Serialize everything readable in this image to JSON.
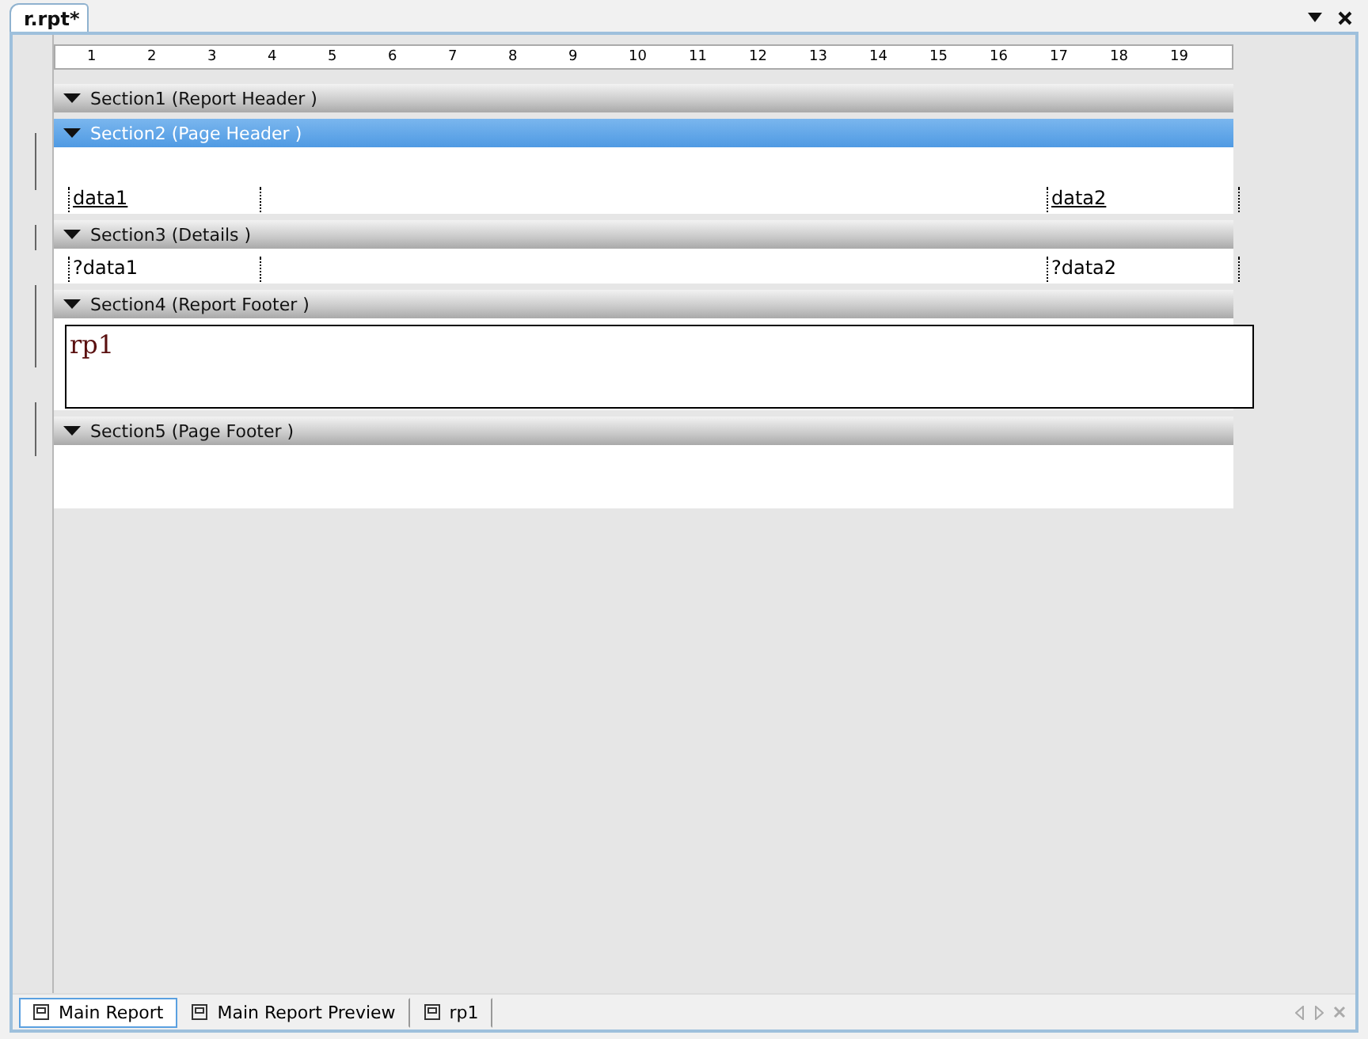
{
  "document_tab": {
    "label": "r.rpt*"
  },
  "ruler": {
    "marks": [
      "1",
      "2",
      "3",
      "4",
      "5",
      "6",
      "7",
      "8",
      "9",
      "10",
      "11",
      "12",
      "13",
      "14",
      "15",
      "16",
      "17",
      "18",
      "19"
    ]
  },
  "sections": [
    {
      "title": "Section1 (Report Header )",
      "selected": false
    },
    {
      "title": "Section2 (Page Header )",
      "selected": true,
      "fields": [
        {
          "kind": "label",
          "text": "data1"
        },
        {
          "kind": "label",
          "text": "data2"
        }
      ]
    },
    {
      "title": "Section3 (Details )",
      "selected": false,
      "fields": [
        {
          "kind": "value",
          "text": "?data1"
        },
        {
          "kind": "value",
          "text": "?data2"
        }
      ]
    },
    {
      "title": "Section4 (Report Footer )",
      "selected": false,
      "fields": [
        {
          "kind": "subreport",
          "text": "rp1"
        }
      ]
    },
    {
      "title": "Section5 (Page Footer )",
      "selected": false,
      "empty_band": true
    }
  ],
  "bottom_tabs": [
    {
      "label": "Main Report",
      "selected": true
    },
    {
      "label": "Main Report Preview",
      "selected": false
    },
    {
      "label": "rp1",
      "selected": false
    }
  ]
}
